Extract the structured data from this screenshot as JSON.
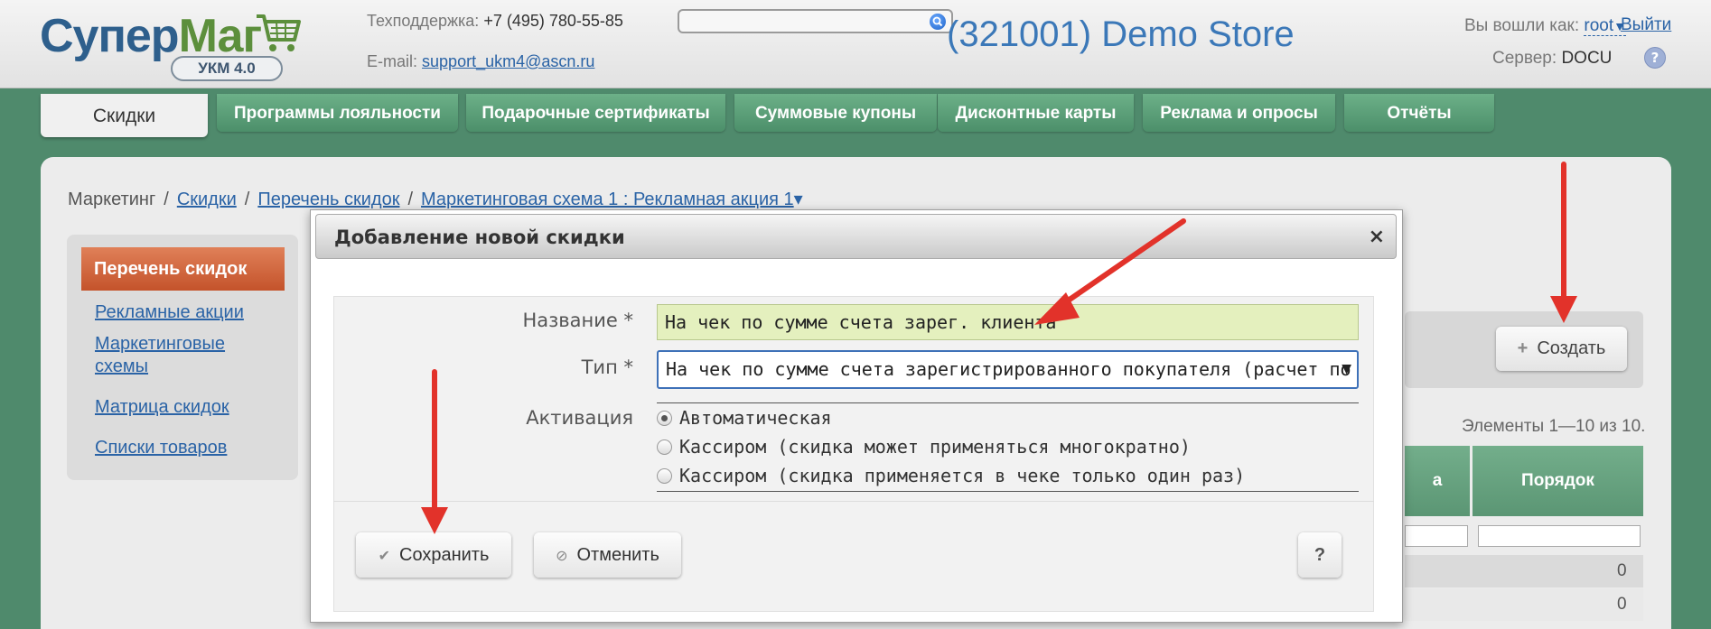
{
  "header": {
    "logo_main": "Супер",
    "logo_accent": "Маг",
    "logo_badge": "УКМ 4.0",
    "support_label": "Техподдержка:",
    "support_phone": "+7 (495) 780-55-85",
    "email_label": "E-mail:",
    "email_value": "support_ukm4@ascn.ru",
    "search_value": "",
    "store_name": "(321001) Demo Store",
    "logged_as_label": "Вы вошли как:",
    "user": "root",
    "user_caret": "▼",
    "logout": "Выйти",
    "server_label": "Сервер:",
    "server_value": "DOCU",
    "help_symbol": "?"
  },
  "tabs": [
    {
      "label": "Скидки",
      "active": true
    },
    {
      "label": "Программы лояльности"
    },
    {
      "label": "Подарочные сертификаты"
    },
    {
      "label": "Суммовые купоны"
    },
    {
      "label": "Дисконтные карты"
    },
    {
      "label": "Реклама и опросы"
    },
    {
      "label": "Отчёты"
    }
  ],
  "breadcrumb": {
    "root": "Маркетинг",
    "sep": "/",
    "items": [
      "Скидки",
      "Перечень скидок",
      "Маркетинговая схема 1 : Рекламная акция 1"
    ],
    "caret": "▾"
  },
  "sidebar": {
    "active": "Перечень скидок",
    "links": [
      "Рекламные акции",
      "Маркетинговые схемы",
      "Матрица скидок",
      "Списки товаров"
    ]
  },
  "list": {
    "create_label": "Создать",
    "create_icon": "+",
    "items_count": "Элементы 1—10 из 10.",
    "col_partial": "а",
    "col_order": "Порядок",
    "row_values": [
      "0",
      "0"
    ]
  },
  "modal": {
    "title": "Добавление новой скидки",
    "close": "×",
    "name_label": "Название *",
    "name_value": "На чек по сумме счета зарег. клиента",
    "type_label": "Тип *",
    "type_value": "На чек по сумме счета зарегистрированного покупателя (расчет по",
    "type_caret": "▼",
    "activation_label": "Активация",
    "activation_options": [
      "Автоматическая",
      "Кассиром (скидка может применяться многократно)",
      "Кассиром (скидка применяется в чеке только один раз)"
    ],
    "activation_selected": 0,
    "save_label": "Сохранить",
    "save_icon": "✔",
    "cancel_label": "Отменить",
    "cancel_icon": "⊘",
    "help_label": "?"
  },
  "colors": {
    "background": "#4f8a6c",
    "tab_green": "#5b9d78",
    "active_side": "#d2663d",
    "link": "#2a63a6",
    "name_input_bg": "#e4f0be",
    "arrow": "#e2322a"
  }
}
